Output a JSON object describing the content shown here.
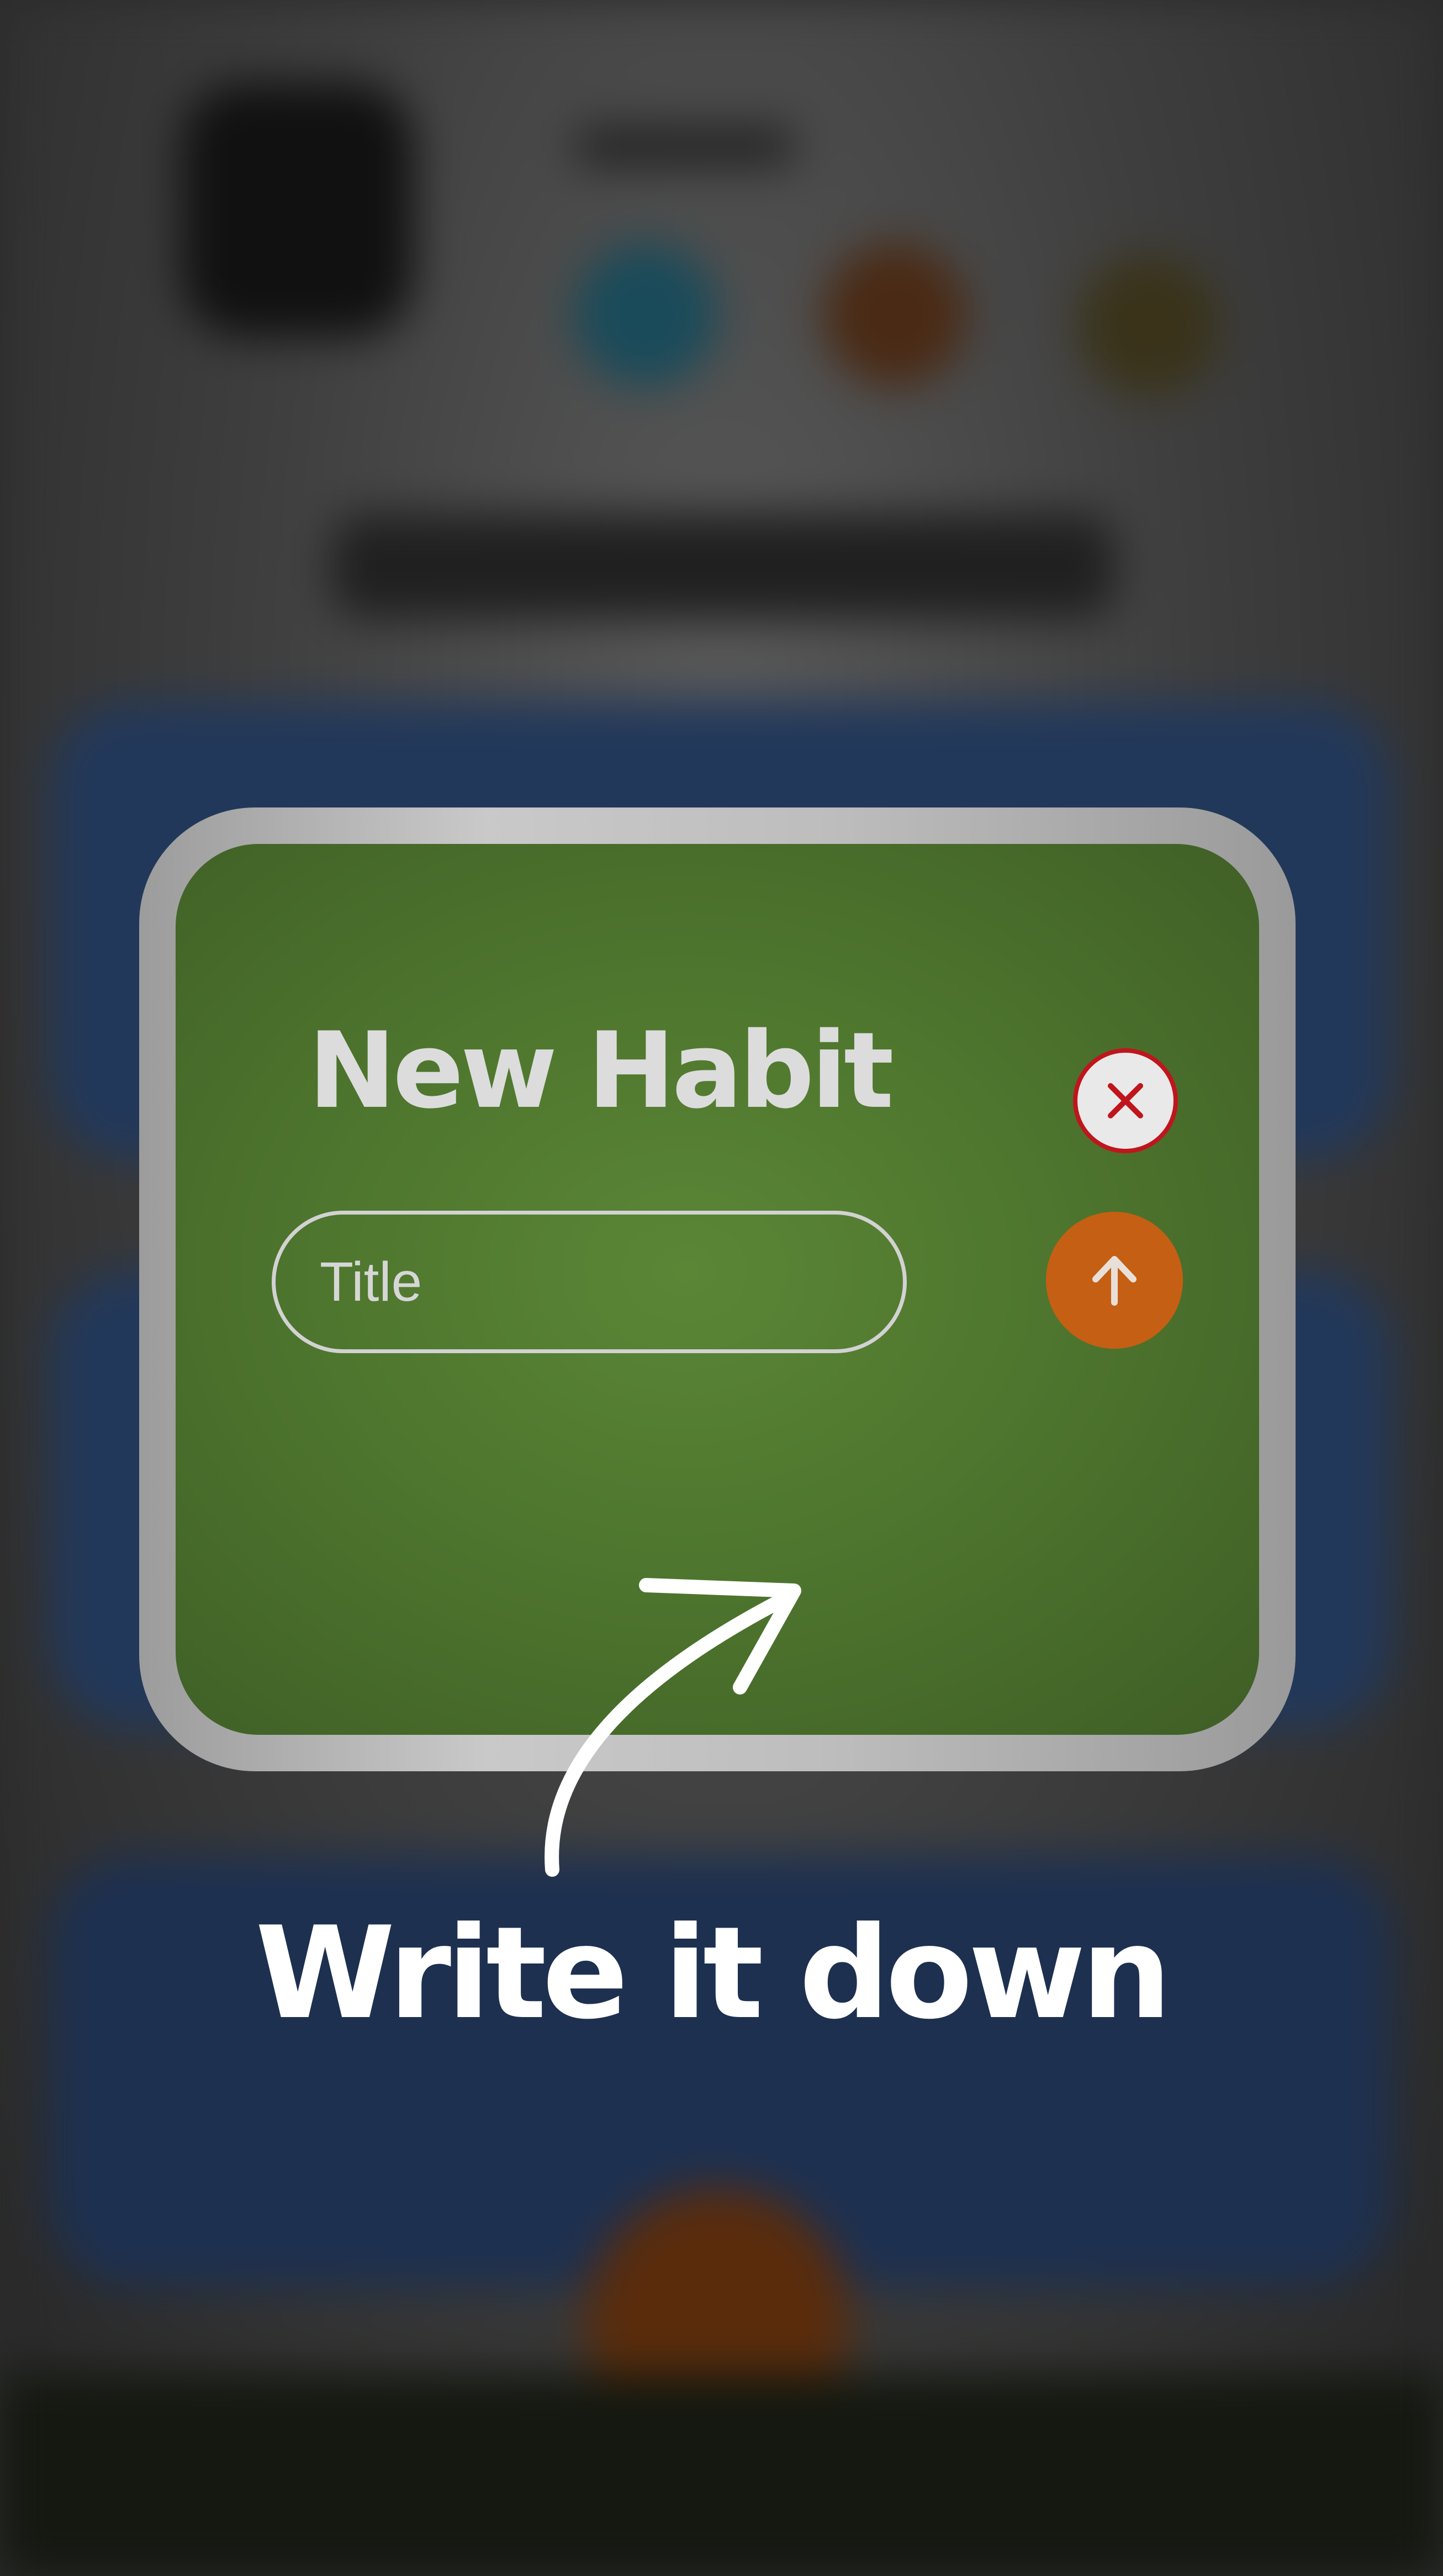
{
  "modal": {
    "title": "New Habit",
    "title_input": {
      "value": "",
      "placeholder": "Title"
    },
    "close_icon": "close-icon",
    "submit_icon": "arrow-up-icon"
  },
  "callout": {
    "text": "Write it down",
    "icon": "curved-arrow-icon"
  },
  "colors": {
    "modal_green": "#4e762e",
    "submit_orange": "#c55f14",
    "close_red": "#c0151c",
    "frame_gray": "#bdbdbd"
  }
}
